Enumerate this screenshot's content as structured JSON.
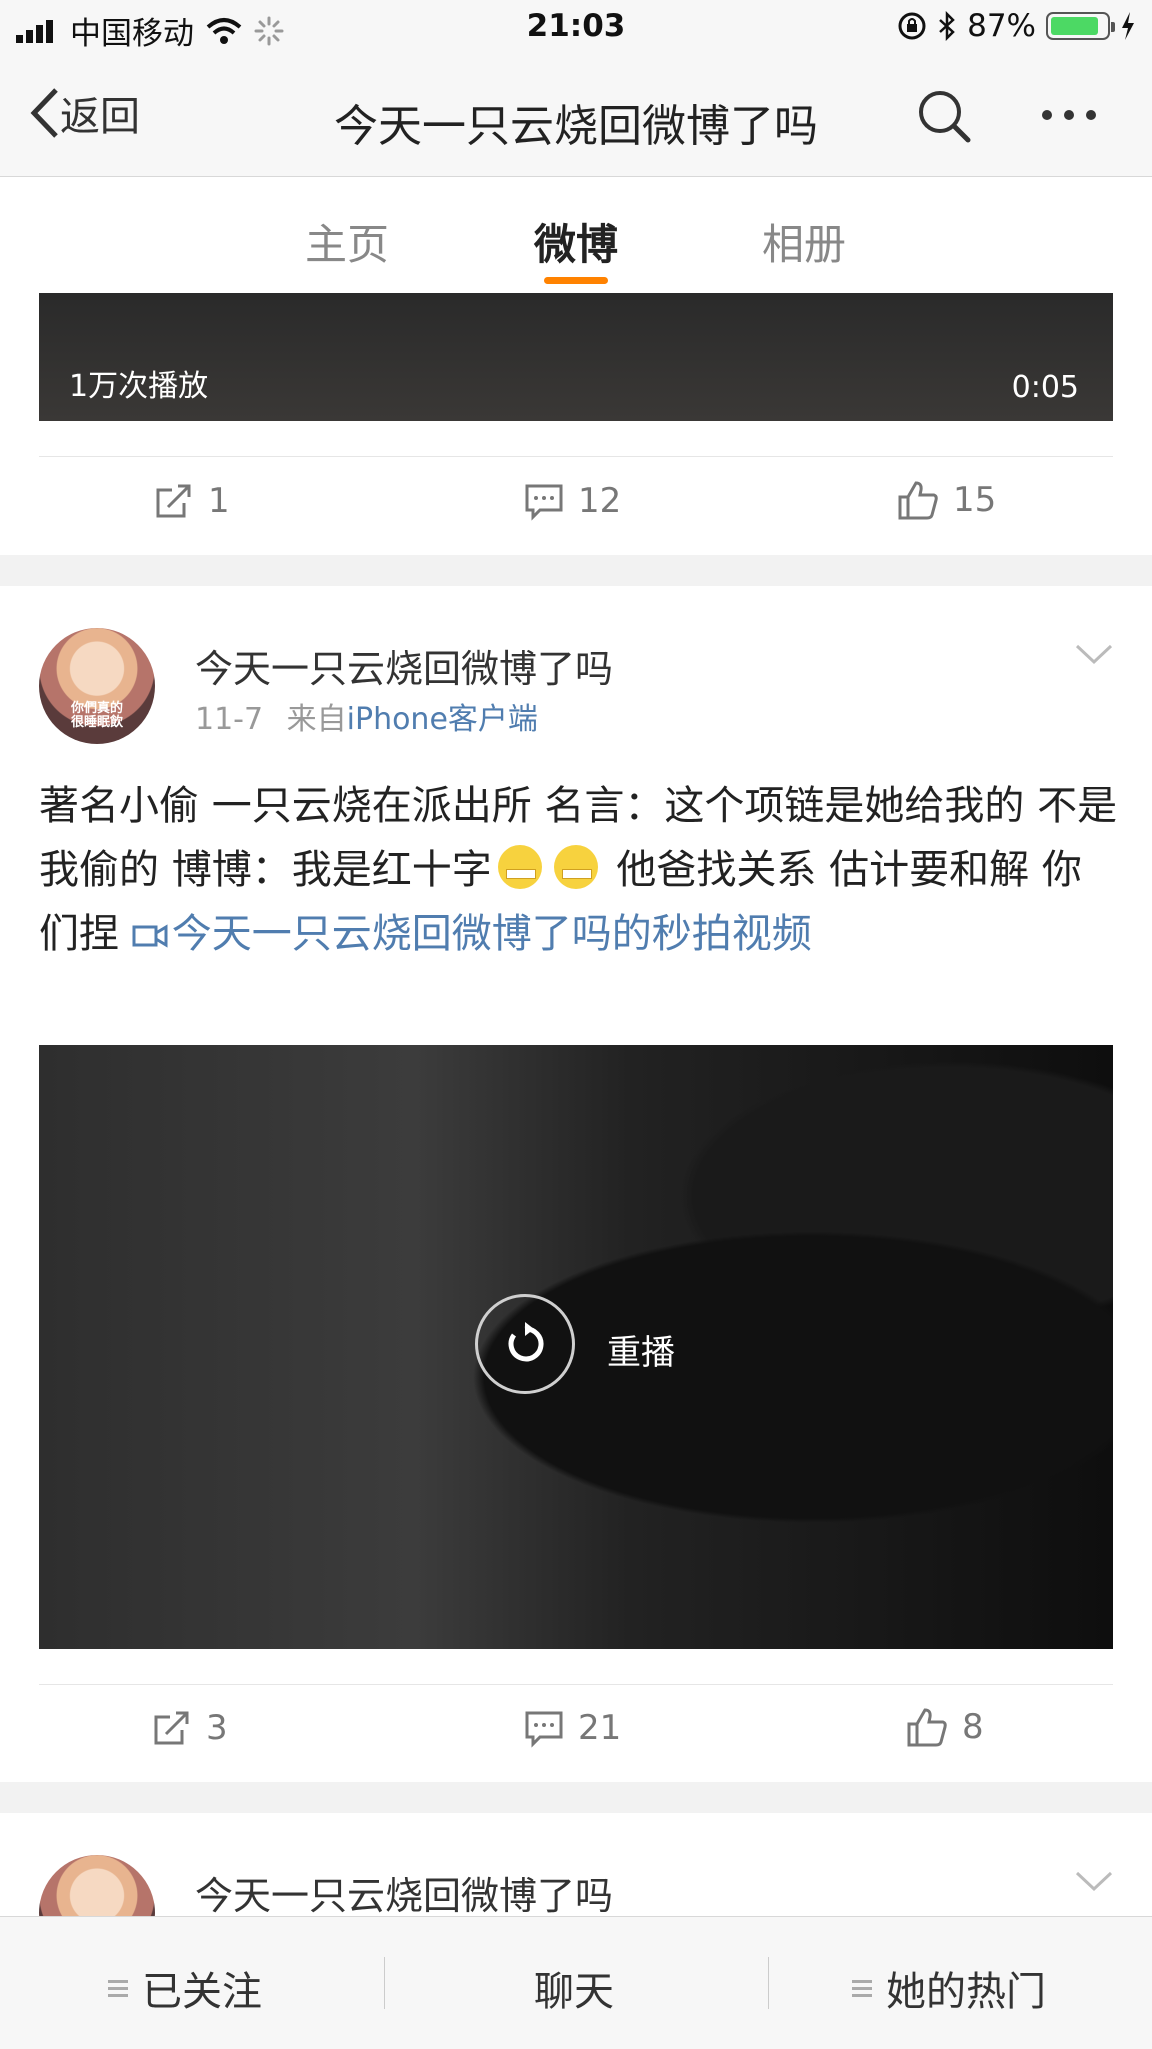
{
  "status_bar": {
    "carrier": "中国移动",
    "time": "21:03",
    "battery": "87%",
    "battery_level": 0.87
  },
  "nav": {
    "back_label": "返回",
    "title": "今天一只云烧回微博了吗"
  },
  "tabs": [
    {
      "label": "主页",
      "active": false
    },
    {
      "label": "微博",
      "active": true
    },
    {
      "label": "相册",
      "active": false
    }
  ],
  "accent_color": "#ff8200",
  "link_color": "#507daf",
  "post1": {
    "play_count": "1万次播放",
    "duration": "0:05",
    "reposts": "1",
    "comments": "12",
    "likes": "15"
  },
  "post2": {
    "username": "今天一只云烧回微博了吗",
    "date": "11-7",
    "source_prefix": "来自",
    "source": "iPhone客户端",
    "avatar_caption_line1": "你們真的",
    "avatar_caption_line2": "很睡眠飲",
    "text_part1": "著名小偷 一只云烧在派出所 名言：这个项链是她给我的 不是我偷的 博博：我是红十字",
    "text_part2": " 他爸找关系 估计要和解 你们捏 ",
    "video_link": "今天一只云烧回微博了吗的秒拍视频",
    "replay_label": "重播",
    "reposts": "3",
    "comments": "21",
    "likes": "8"
  },
  "post3": {
    "username": "今天一只云烧回微博了吗"
  },
  "bottom_bar": {
    "following": "已关注",
    "chat": "聊天",
    "hot": "她的热门"
  }
}
